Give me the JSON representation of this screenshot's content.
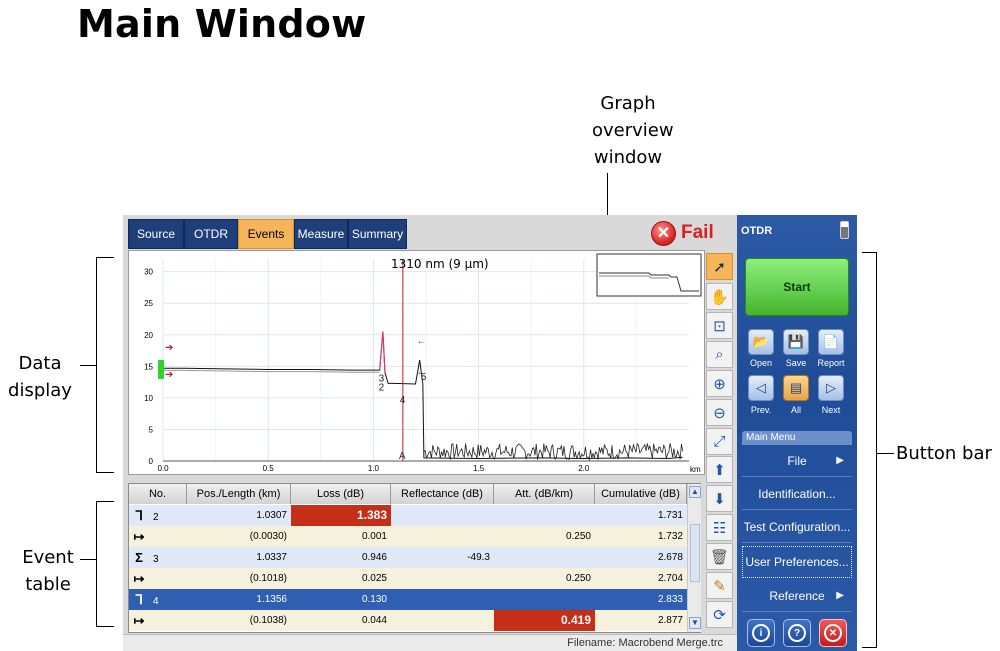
{
  "heading": "Main Window",
  "callouts": {
    "graph_overview": [
      "Graph",
      "overview",
      "window"
    ],
    "data_display": [
      "Data",
      "display"
    ],
    "event_table": [
      "Event",
      "table"
    ],
    "button_bar": "Button bar"
  },
  "tabs": [
    {
      "label": "Source",
      "active": false
    },
    {
      "label": "OTDR",
      "active": false
    },
    {
      "label": "Events",
      "active": true
    },
    {
      "label": "Measure",
      "active": false
    },
    {
      "label": "Summary",
      "active": false
    }
  ],
  "status": {
    "label": "Fail",
    "color": "#dd1f1f"
  },
  "graph": {
    "wavelength_label": "1310 nm (9 µm)",
    "x_unit": "km",
    "marker_a": "A",
    "event_labels": [
      "3",
      "2",
      "4",
      "5"
    ]
  },
  "chart_data": {
    "type": "line",
    "xlim": [
      0,
      2.5
    ],
    "ylim": [
      0,
      32
    ],
    "x_ticks": [
      "0.0",
      "0.5",
      "1.0",
      "1.5",
      "2.0"
    ],
    "y_ticks": [
      "0",
      "5",
      "10",
      "15",
      "20",
      "25",
      "30"
    ],
    "xlabel": "km",
    "series": [
      {
        "x": [
          0.0,
          0.02,
          0.1,
          0.3,
          0.5,
          0.7,
          0.9,
          1.0,
          1.03,
          1.045,
          1.055,
          1.07,
          1.1,
          1.2,
          1.22,
          1.235,
          1.24,
          1.5,
          1.8,
          2.0,
          2.2,
          2.4,
          2.47
        ],
        "values": [
          14.7,
          14.7,
          14.7,
          14.6,
          14.5,
          14.5,
          14.4,
          14.4,
          14.4,
          20.5,
          14.0,
          12.3,
          12.3,
          12.2,
          16.0,
          12.2,
          0.5,
          0.4,
          0.5,
          0.4,
          0.5,
          0.4,
          0.6
        ]
      }
    ],
    "noise_floor": {
      "x_start": 1.24,
      "x_end": 2.47,
      "level_min": 0.2,
      "level_max": 2.8
    },
    "marker_a_x": 1.14,
    "grid": true
  },
  "event_table": {
    "columns": [
      "No.",
      "Pos./Length (km)",
      "Loss (dB)",
      "Reflectance (dB)",
      "Att. (dB/km)",
      "Cumulative (dB)"
    ],
    "rows": [
      {
        "symbol": "ᒣ",
        "no": "2",
        "pos": "1.0307",
        "loss": "1.383",
        "refl": "",
        "att": "",
        "cum": "1.731",
        "loss_fail": true,
        "att_fail": false,
        "selected": false
      },
      {
        "symbol": "↦",
        "no": "",
        "pos": "(0.0030)",
        "loss": "0.001",
        "refl": "",
        "att": "0.250",
        "cum": "1.732",
        "loss_fail": false,
        "att_fail": false,
        "selected": false
      },
      {
        "symbol": "Σ",
        "no": "3",
        "pos": "1.0337",
        "loss": "0.946",
        "refl": "-49.3",
        "att": "",
        "cum": "2.678",
        "loss_fail": false,
        "att_fail": false,
        "selected": false
      },
      {
        "symbol": "↦",
        "no": "",
        "pos": "(0.1018)",
        "loss": "0.025",
        "refl": "",
        "att": "0.250",
        "cum": "2.704",
        "loss_fail": false,
        "att_fail": false,
        "selected": false
      },
      {
        "symbol": "ᒣ",
        "no": "4",
        "pos": "1.1356",
        "loss": "0.130",
        "refl": "",
        "att": "",
        "cum": "2.833",
        "loss_fail": false,
        "att_fail": false,
        "selected": true
      },
      {
        "symbol": "↦",
        "no": "",
        "pos": "(0.1038)",
        "loss": "0.044",
        "refl": "",
        "att": "0.419",
        "cum": "2.877",
        "loss_fail": false,
        "att_fail": true,
        "selected": false
      }
    ]
  },
  "statusbar": {
    "filename": "Filename: Macrobend  Merge.trc"
  },
  "button_bar": {
    "title": "OTDR",
    "start_label": "Start",
    "file_buttons": [
      {
        "label": "Open",
        "icon": "folder-open-icon"
      },
      {
        "label": "Save",
        "icon": "floppy-disk-icon"
      },
      {
        "label": "Report",
        "icon": "report-icon"
      }
    ],
    "nav_buttons": [
      {
        "label": "Prev.",
        "icon": "previous-trace-icon",
        "selected": false
      },
      {
        "label": "All",
        "icon": "all-traces-icon",
        "selected": true
      },
      {
        "label": "Next",
        "icon": "next-trace-icon",
        "selected": false
      }
    ],
    "menu_title": "Main Menu",
    "menu_items": [
      {
        "label": "File",
        "has_arrow": true
      },
      {
        "label": "Identification...",
        "has_arrow": false
      },
      {
        "label": "Test Configuration...",
        "has_arrow": false
      },
      {
        "label": "User Preferences...",
        "has_arrow": false
      },
      {
        "label": "Reference",
        "has_arrow": true
      }
    ]
  }
}
